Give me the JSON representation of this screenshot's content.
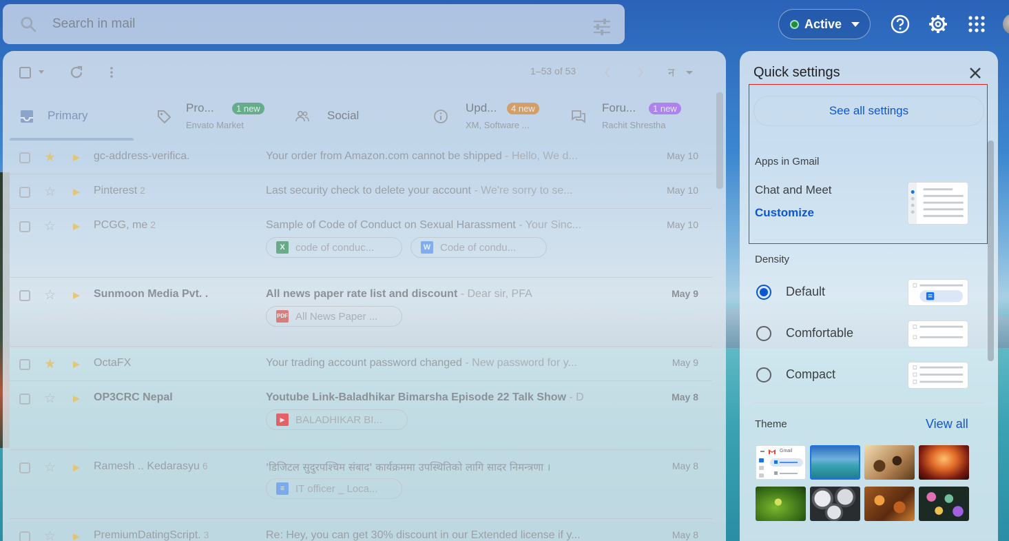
{
  "search": {
    "placeholder": "Search in mail"
  },
  "status": {
    "label": "Active",
    "color": "#1e8e3e"
  },
  "top_icons": [
    "help-icon",
    "gear-icon",
    "apps-grid-icon",
    "avatar"
  ],
  "mail": {
    "pagination": "1–53 of 53",
    "tabs": [
      {
        "name": "Primary",
        "icon": "inbox-icon"
      },
      {
        "name": "Pro...",
        "sub": "Envato Market",
        "badge": "1 new",
        "badge_color": "#1e8e3e",
        "icon": "tag-icon"
      },
      {
        "name": "Social",
        "icon": "people-icon"
      },
      {
        "name": "Upd...",
        "sub": "XM, Software ...",
        "badge": "4 new",
        "badge_color": "#e37400",
        "icon": "info-icon"
      },
      {
        "name": "Foru...",
        "sub": "Rachit Shrestha",
        "badge": "1 new",
        "badge_color": "#a142f4",
        "icon": "forum-icon"
      }
    ],
    "rows": [
      {
        "sender": "gc-address-verifica.",
        "count": "",
        "subject": "Your order from Amazon.com cannot be shipped",
        "snippet": " - Hello, We d...",
        "date": "May 10",
        "unread": false,
        "starred": true
      },
      {
        "sender": "Pinterest",
        "count": "2",
        "subject": "Last security check to delete your account",
        "snippet": " - We're sorry to se...",
        "date": "May 10",
        "unread": false,
        "starred": false
      },
      {
        "sender": "PCGG, me",
        "count": "2",
        "subject": "Sample of Code of Conduct on Sexual Harassment",
        "snippet": " - Your Sinc...",
        "date": "May 10",
        "unread": false,
        "starred": false,
        "attachments": [
          {
            "name": "code of conduc...",
            "type": "X",
            "color": "#188038"
          },
          {
            "name": "Code of condu...",
            "type": "W",
            "color": "#4285f4"
          }
        ]
      },
      {
        "sender": "Sunmoon Media Pvt. .",
        "count": "",
        "subject": "All news paper rate list and discount",
        "snippet": " - Dear sir, PFA",
        "date": "May 9",
        "unread": true,
        "starred": false,
        "attachments": [
          {
            "name": "All News Paper ...",
            "type": "PDF",
            "color": "#d93025"
          }
        ]
      },
      {
        "sender": "OctaFX",
        "count": "",
        "subject": "Your trading account password changed",
        "snippet": " - New password for y...",
        "date": "May 9",
        "unread": false,
        "starred": true
      },
      {
        "sender": "OP3CRC Nepal",
        "count": "",
        "subject": "Youtube Link-Baladhikar Bimarsha Episode 22 Talk Show",
        "snippet": " - D",
        "date": "May 8",
        "unread": true,
        "starred": false,
        "attachments": [
          {
            "name": "BALADHIKAR BI...",
            "type": "▶",
            "color": "#ff0000"
          }
        ]
      },
      {
        "sender": "Ramesh .. Kedarasyu",
        "count": "6",
        "subject": "'डिजिटल सुदुरपश्चिम संबाद' कार्यक्रममा उपस्थितिको लागि सादर निमन्त्रणा ।",
        "snippet": "",
        "date": "May 8",
        "unread": false,
        "starred": false,
        "attachments": [
          {
            "name": "IT officer _ Loca...",
            "type": "≡",
            "color": "#4285f4"
          }
        ]
      },
      {
        "sender": "PremiumDatingScript.",
        "count": "3",
        "subject": "Re: Hey, you can get 30% discount in our Extended license if y...",
        "snippet": "",
        "date": "May 8",
        "unread": false,
        "starred": false
      }
    ]
  },
  "quick_settings": {
    "title": "Quick settings",
    "see_all": "See all settings",
    "apps_heading": "Apps in Gmail",
    "chat_meet": "Chat and Meet",
    "customize": "Customize",
    "density_heading": "Density",
    "density_options": [
      {
        "label": "Default",
        "selected": true
      },
      {
        "label": "Comfortable",
        "selected": false
      },
      {
        "label": "Compact",
        "selected": false
      }
    ],
    "theme_heading": "Theme",
    "view_all": "View all",
    "theme_preview_label": "Gmail",
    "themes": [
      {
        "name": "default-gmail-theme"
      },
      {
        "name": "lake-theme",
        "c1": "#2d86c8",
        "c2": "#3aa3b0"
      },
      {
        "name": "chess-theme",
        "c1": "#e4c896",
        "c2": "#5a3a1a"
      },
      {
        "name": "canyon-theme",
        "c1": "#f0a050",
        "c2": "#4a1010"
      },
      {
        "name": "leaf-bug-theme",
        "c1": "#8ac43a",
        "c2": "#2a5a10"
      },
      {
        "name": "pipes-theme",
        "c1": "#c8ccd0",
        "c2": "#303438"
      },
      {
        "name": "autumn-leaves-theme",
        "c1": "#d08030",
        "c2": "#5a2a10"
      },
      {
        "name": "bokeh-theme",
        "c1": "#c05aa0",
        "c2": "#204030"
      }
    ]
  }
}
